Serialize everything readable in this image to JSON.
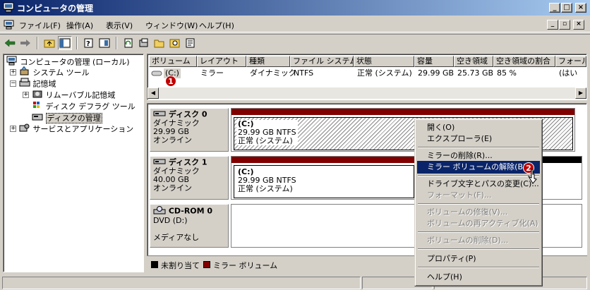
{
  "window": {
    "title": "コンピュータの管理"
  },
  "menu": {
    "items": [
      "ファイル(F)",
      "操作(A)",
      "表示(V)",
      "ウィンドウ(W)",
      "ヘルプ(H)"
    ]
  },
  "toolbar": {
    "icons": [
      "back-arrow-icon",
      "forward-arrow-icon",
      "up-folder-icon",
      "show-hide-tree-icon",
      "properties-icon",
      "help-icon",
      "refresh-icon",
      "settings-icon",
      "folder-open-icon",
      "search-icon",
      "export-icon"
    ]
  },
  "tree": {
    "root": "コンピュータの管理 (ローカル)",
    "system_tools": "システム ツール",
    "storage": "記憶域",
    "removable": "リムーバブル記憶域",
    "defrag": "ディスク デフラグ ツール",
    "disk_mgmt": "ディスクの管理",
    "services": "サービスとアプリケーション"
  },
  "volume_list": {
    "columns": [
      "ボリューム",
      "レイアウト",
      "種類",
      "ファイル システム",
      "状態",
      "容量",
      "空き領域",
      "空き領域の割合",
      "フォール"
    ],
    "row": [
      "(C:)",
      "ミラー",
      "ダイナミック",
      "NTFS",
      "正常 (システム)",
      "29.99 GB",
      "25.73 GB",
      "85 %",
      "(はい"
    ]
  },
  "disks": [
    {
      "name": "ディスク 0",
      "type": "ダイナミック",
      "size": "29.99 GB",
      "status": "オンライン",
      "vol_name": "(C:)",
      "vol_size": "29.99 GB NTFS",
      "vol_status": "正常 (システム)"
    },
    {
      "name": "ディスク 1",
      "type": "ダイナミック",
      "size": "40.00 GB",
      "status": "オンライン",
      "vol_name": "(C:)",
      "vol_size": "29.99 GB NTFS",
      "vol_status": "正常 (システム)"
    },
    {
      "name": "CD-ROM 0",
      "type": "DVD (D:)",
      "size": "",
      "status": "メディアなし"
    }
  ],
  "legend": {
    "unallocated": "未割り当て",
    "mirror": "ミラー ボリューム",
    "unallocated_color": "#000000",
    "mirror_color": "#800000"
  },
  "context_menu": {
    "open": "開く(O)",
    "explorer": "エクスプローラ(E)",
    "remove_mirror": "ミラーの削除(R)...",
    "break_mirror": "ミラー ボリュームの解除(B)...",
    "change_letter": "ドライブ文字とパスの変更(C)...",
    "format": "フォーマット(F)...",
    "repair": "ボリュームの修復(V)...",
    "reactivate": "ボリュームの再アクティブ化(A)",
    "delete": "ボリュームの削除(D)...",
    "properties": "プロパティ(P)",
    "help": "ヘルプ(H)"
  },
  "annotations": {
    "badge1": "1",
    "badge2": "2"
  }
}
